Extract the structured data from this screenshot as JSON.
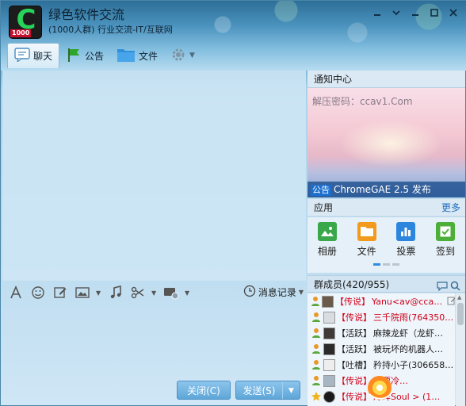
{
  "window": {
    "group_name": "绿色软件交流",
    "group_sub": "(1000人群) 行业交流-IT/互联网",
    "logo_badge": "1000",
    "logo_letter": "C",
    "controls": [
      "minimize-icon",
      "arrow-icon",
      "minimize-icon",
      "maximize-icon",
      "close-icon"
    ]
  },
  "tabs": [
    {
      "label": "聊天",
      "icon": "chat-icon",
      "active": true
    },
    {
      "label": "公告",
      "icon": "flag-icon",
      "active": false
    },
    {
      "label": "文件",
      "icon": "folder-icon",
      "active": false
    }
  ],
  "settings_icon": "gear-icon",
  "toolbar": {
    "icons": [
      "font-icon",
      "emoji-icon",
      "edit-icon",
      "image-icon",
      "music-icon",
      "scissors-icon",
      "screen-share-icon"
    ],
    "history_label": "消息记录"
  },
  "buttons": {
    "close_label": "关闭(C)",
    "send_label": "发送(S)"
  },
  "notice": {
    "header": "通知中心",
    "hint": "解压密码：ccav1.Com",
    "tag": "公告",
    "caption": "ChromeGAE 2.5 发布"
  },
  "apps": {
    "header": "应用",
    "more": "更多",
    "items": [
      {
        "label": "相册",
        "icon": "photo-album-icon",
        "color": "#3aa84a"
      },
      {
        "label": "文件",
        "icon": "folder-icon",
        "color": "#f29a1b"
      },
      {
        "label": "投票",
        "icon": "vote-icon",
        "color": "#2c86de"
      },
      {
        "label": "签到",
        "icon": "checkin-icon",
        "color": "#4caf3a"
      }
    ]
  },
  "members": {
    "header": "群成员(420/955)",
    "list": [
      {
        "tag": "【传说】",
        "name": "Yanu<av@cca…",
        "red": true
      },
      {
        "tag": "【传说】",
        "name": "三千院雨(764350…",
        "red": true
      },
      {
        "tag": "【活跃】",
        "name": "麻辣龙虾（龙虾…",
        "red": false
      },
      {
        "tag": "【活跃】",
        "name": "被玩坏的机器人…",
        "red": false
      },
      {
        "tag": "【吐槽】",
        "name": "矜持小子(306658…",
        "red": false
      },
      {
        "tag": "【传说】",
        "name": "需要冷…",
        "red": true
      },
      {
        "tag": "【传说】",
        "name": "冷眸Soul > (1…",
        "red": true
      }
    ]
  },
  "colors": {
    "accent": "#1f6fbf",
    "legend_red": "#d0021b",
    "send_button": "#5ea6d8"
  }
}
